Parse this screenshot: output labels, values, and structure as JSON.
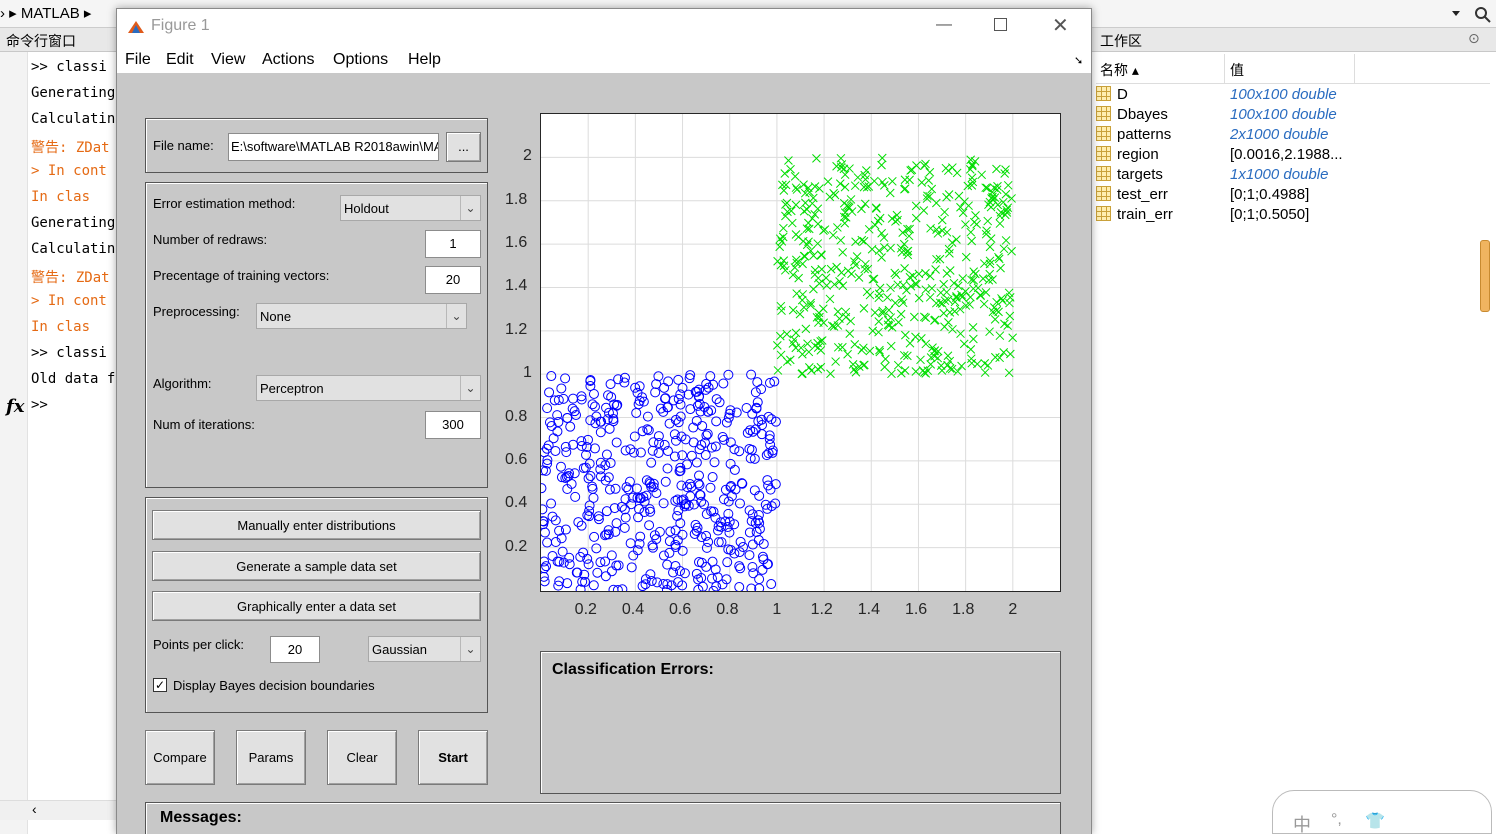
{
  "matlab": {
    "breadcrumb": "› ▸ MATLAB ▸",
    "cmd_title": "命令行窗口",
    "lines": [
      {
        "text": ">> classi",
        "cls": ""
      },
      {
        "text": "Generating",
        "cls": ""
      },
      {
        "text": "Calculatin",
        "cls": ""
      },
      {
        "text": "警告: ZDat",
        "cls": "orange"
      },
      {
        "text": "> In cont",
        "cls": "orange"
      },
      {
        "text": "  In clas",
        "cls": "orange"
      },
      {
        "text": "Generating",
        "cls": ""
      },
      {
        "text": "Calculatin",
        "cls": ""
      },
      {
        "text": "警告: ZDat",
        "cls": "orange"
      },
      {
        "text": "> In cont",
        "cls": "orange"
      },
      {
        "text": "  In clas",
        "cls": "orange"
      },
      {
        "text": ">>  classi",
        "cls": ""
      },
      {
        "text": "Old data f",
        "cls": ""
      },
      {
        "text": ">>",
        "cls": ""
      }
    ],
    "fx": "fx",
    "workspace": {
      "title": "工作区",
      "col_name": "名称 ▴",
      "col_value": "值",
      "vars": [
        {
          "name": "D",
          "value": "100x100 double",
          "italic": true
        },
        {
          "name": "Dbayes",
          "value": "100x100 double",
          "italic": true
        },
        {
          "name": "patterns",
          "value": "2x1000 double",
          "italic": true
        },
        {
          "name": "region",
          "value": "[0.0016,2.1988...",
          "italic": false
        },
        {
          "name": "targets",
          "value": "1x1000 double",
          "italic": true
        },
        {
          "name": "test_err",
          "value": "[0;1;0.4988]",
          "italic": false
        },
        {
          "name": "train_err",
          "value": "[0;1;0.5050]",
          "italic": false
        }
      ]
    }
  },
  "figure": {
    "title": "Figure 1",
    "menu": [
      "File",
      "Edit",
      "View",
      "Actions",
      "Options",
      "Help"
    ],
    "file_label": "File name:",
    "file_value": "E:\\software\\MATLAB R2018awin\\MA",
    "browse_label": "...",
    "err_method_label": "Error estimation method:",
    "err_method_value": "Holdout",
    "redraws_label": "Number of redraws:",
    "redraws_value": "1",
    "pct_label": "Precentage of training vectors:",
    "pct_value": "20",
    "preproc_label": "Preprocessing:",
    "preproc_value": "None",
    "algo_label": "Algorithm:",
    "algo_value": "Perceptron",
    "iter_label": "Num of iterations:",
    "iter_value": "300",
    "btn_manual": "Manually enter distributions",
    "btn_generate": "Generate a sample data set",
    "btn_graphic": "Graphically enter a data set",
    "ppc_label": "Points per click:",
    "ppc_value": "20",
    "dist_value": "Gaussian",
    "bayes_label": "Display Bayes decision boundaries",
    "bayes_checked": true,
    "btn_compare": "Compare",
    "btn_params": "Params",
    "btn_clear": "Clear",
    "btn_start": "Start",
    "class_errors": "Classification Errors:",
    "messages": "Messages:"
  },
  "chart_data": {
    "type": "scatter",
    "xlim": [
      0,
      2.2
    ],
    "ylim": [
      0,
      2.2
    ],
    "xticks": [
      "0.2",
      "0.4",
      "0.6",
      "0.8",
      "1",
      "1.2",
      "1.4",
      "1.6",
      "1.8",
      "2"
    ],
    "yticks": [
      "0.2",
      "0.4",
      "0.6",
      "0.8",
      "1",
      "1.2",
      "1.4",
      "1.6",
      "1.8",
      "2"
    ],
    "grid": true,
    "series": [
      {
        "marker": "circle",
        "color": "#0000ff",
        "count": 500,
        "x_range": [
          0,
          1
        ],
        "y_range": [
          0,
          1
        ]
      },
      {
        "marker": "cross",
        "color": "#00dd00",
        "count": 500,
        "x_range": [
          1,
          2
        ],
        "y_range": [
          1,
          2
        ]
      }
    ]
  }
}
